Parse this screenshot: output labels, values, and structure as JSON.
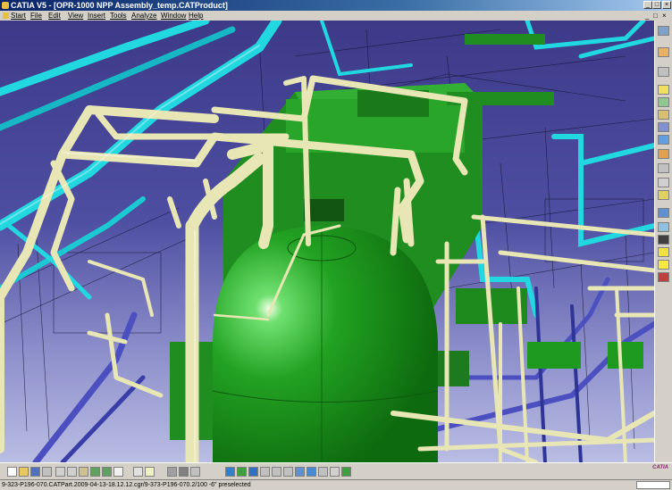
{
  "window": {
    "title": "CATIA V5 - [OPR-1000 NPP Assembly_temp.CATProduct]",
    "controls": [
      "minimize-icon",
      "maximize-icon",
      "close-icon"
    ]
  },
  "menu": {
    "items": [
      "Start",
      "File",
      "Edit",
      "View",
      "Insert",
      "Tools",
      "Analyze",
      "Window",
      "Help"
    ]
  },
  "viewport": {
    "description_icon": "3d-plant-model",
    "colors": {
      "background_top": "#3d3a88",
      "background_bottom": "#b9bde3",
      "vessel_green": "#1e9b1e",
      "pipe_beige": "#e8e6b4",
      "pipe_cyan": "#22d8e0",
      "pipe_blue": "#4b4fc0"
    }
  },
  "toolbars": {
    "right_icons": [
      "tree-icon",
      "sketch-icon",
      "constraint-icon",
      "select-icon",
      "copy-icon",
      "rotate-icon",
      "move-icon",
      "assembly-icon",
      "snap-icon",
      "measure-icon",
      "section-icon",
      "clash-icon",
      "filter-icon",
      "layer-icon",
      "grid-icon",
      "render-icon",
      "bulb-icon",
      "tools-icon"
    ],
    "bottom_icons": [
      "new-icon",
      "open-icon",
      "save-icon",
      "print-icon",
      "cut-icon",
      "copy-icon",
      "paste-icon",
      "undo-icon",
      "redo-icon",
      "whats-this-icon",
      "formula-icon",
      "comment-icon",
      "knowledge-icon",
      "camera-icon",
      "fly-icon",
      "fit-all-icon",
      "pan-icon",
      "rotate-icon",
      "zoom-in-icon",
      "zoom-out-icon",
      "normal-view-icon",
      "iso-view-icon",
      "shading-icon",
      "hide-show-icon",
      "swap-icon",
      "show-icon"
    ],
    "brand_label": "CATIA"
  },
  "status": {
    "text": "9-323-P196-070.CATPart.2009-04-13-18.12.12.cgr/9-373-P196-070.2/100 -6\" preselected"
  }
}
